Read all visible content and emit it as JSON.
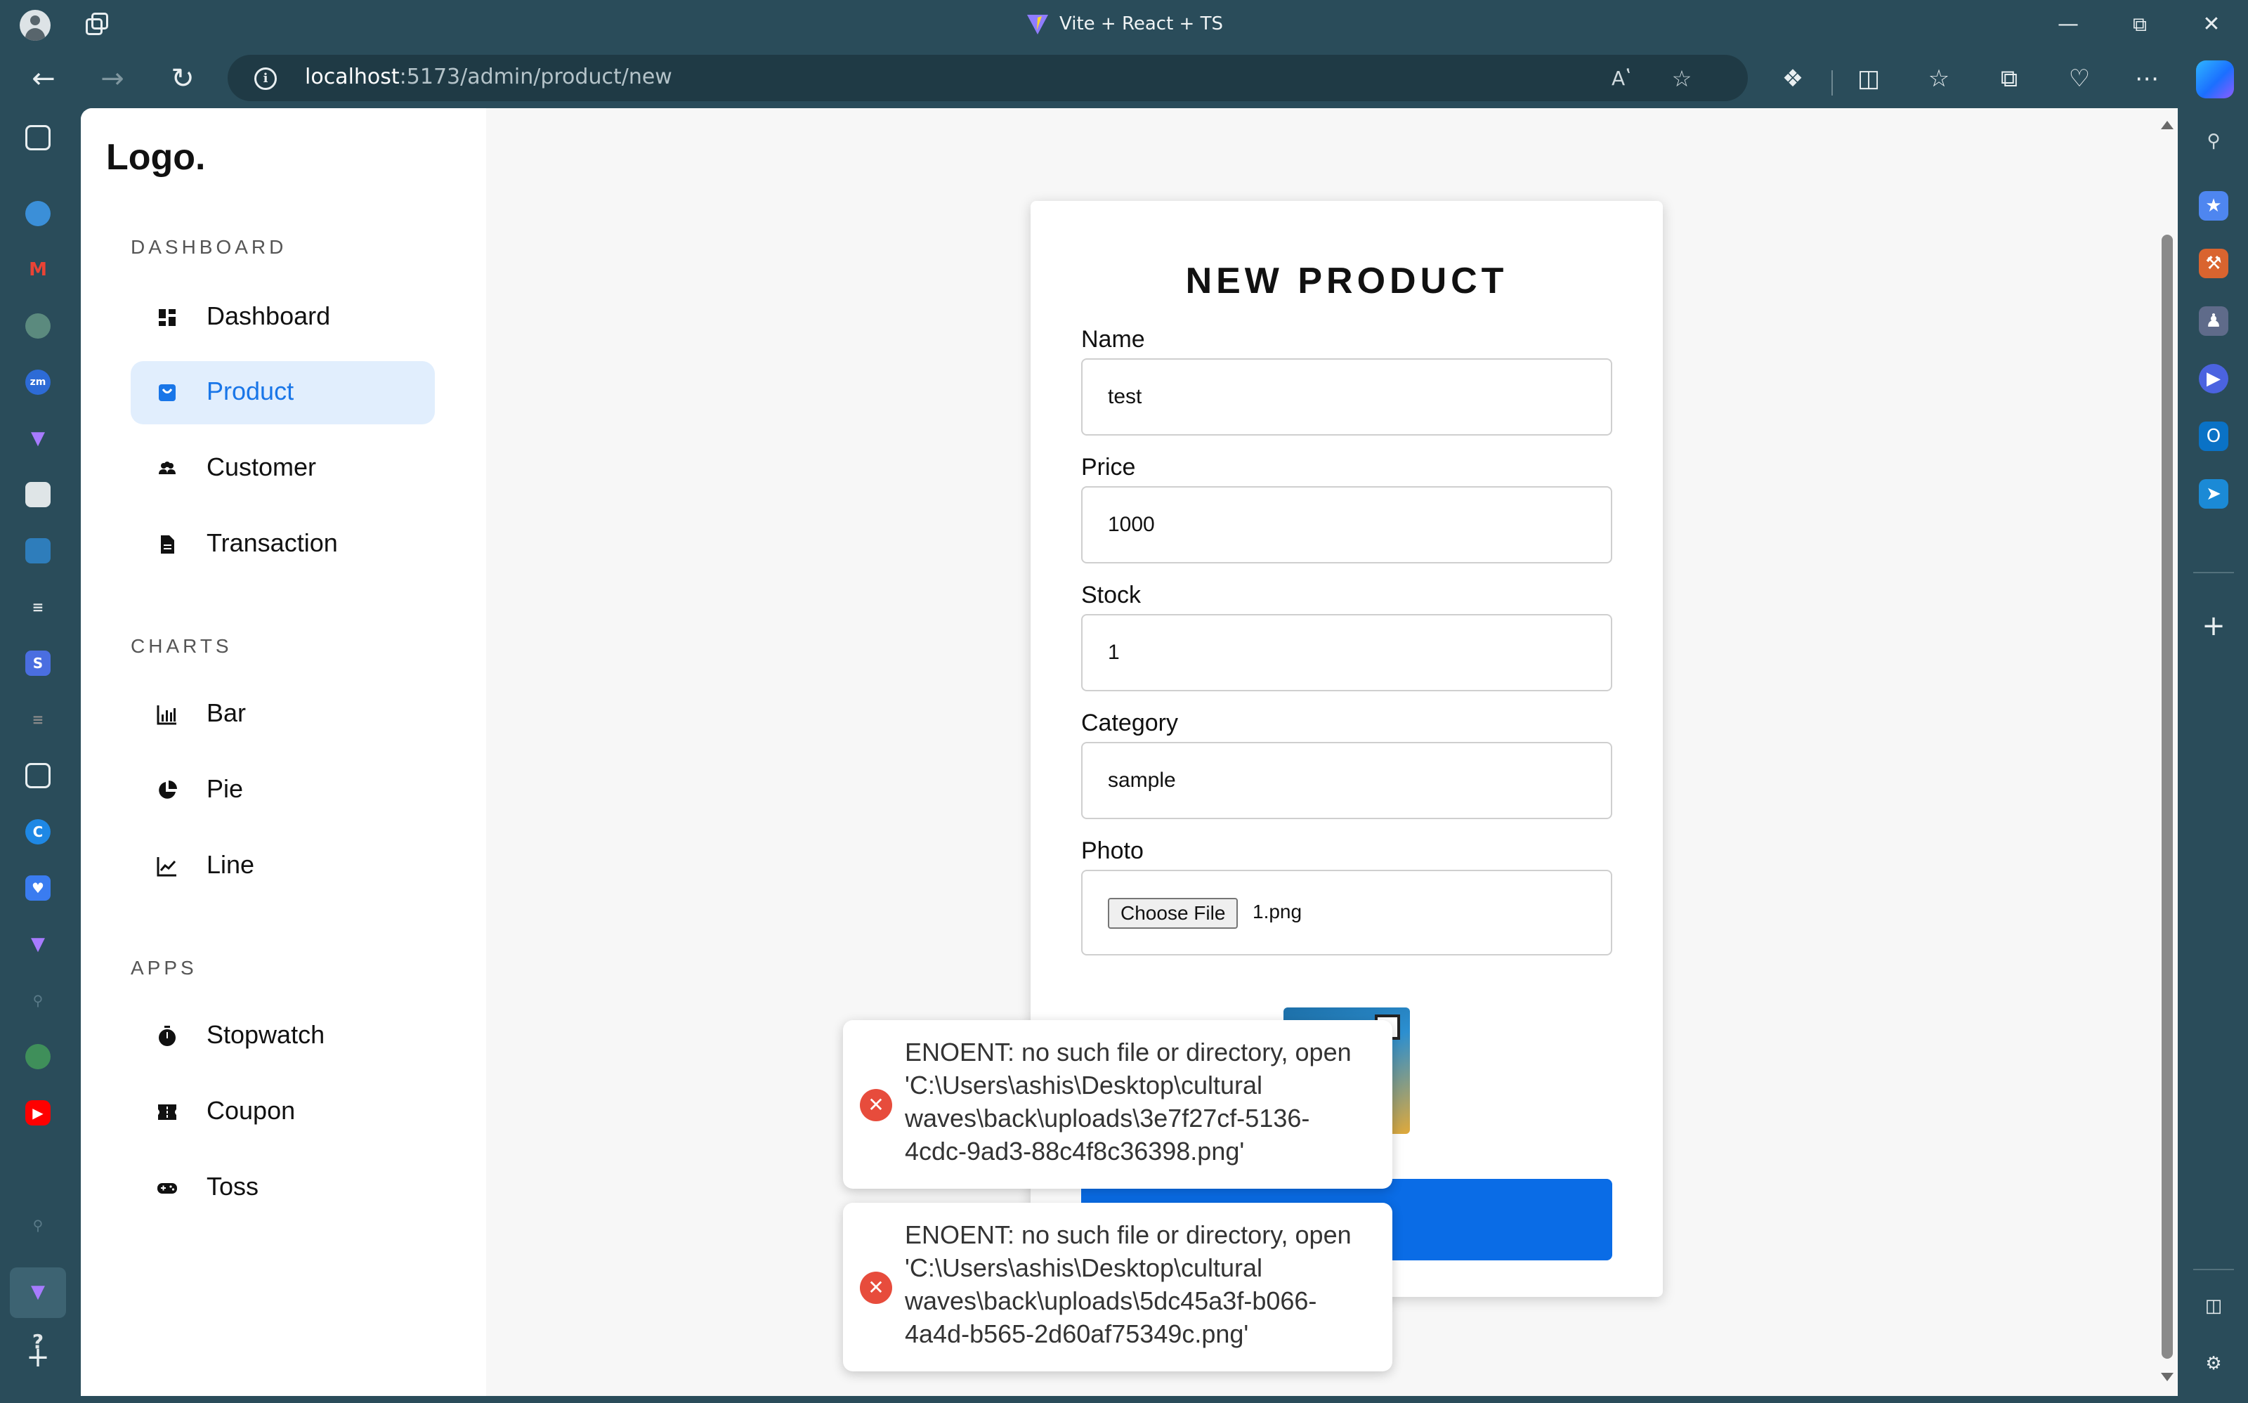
{
  "browser": {
    "window_title": "Vite + React + TS",
    "url_host": "localhost",
    "url_path": ":5173/admin/product/new",
    "controls": {
      "minimize": "—",
      "restore": "⧉",
      "close": "✕"
    }
  },
  "sidebar": {
    "logo": "Logo.",
    "sections": [
      {
        "label": "DASHBOARD",
        "items": [
          {
            "label": "Dashboard",
            "icon": "dashboard-icon",
            "active": false
          },
          {
            "label": "Product",
            "icon": "shopping-bag-icon",
            "active": true
          },
          {
            "label": "Customer",
            "icon": "people-icon",
            "active": false
          },
          {
            "label": "Transaction",
            "icon": "document-icon",
            "active": false
          }
        ]
      },
      {
        "label": "CHARTS",
        "items": [
          {
            "label": "Bar",
            "icon": "bar-chart-icon"
          },
          {
            "label": "Pie",
            "icon": "pie-chart-icon"
          },
          {
            "label": "Line",
            "icon": "line-chart-icon"
          }
        ]
      },
      {
        "label": "APPS",
        "items": [
          {
            "label": "Stopwatch",
            "icon": "stopwatch-icon"
          },
          {
            "label": "Coupon",
            "icon": "coupon-icon"
          },
          {
            "label": "Toss",
            "icon": "gamepad-icon"
          }
        ]
      }
    ]
  },
  "form": {
    "title": "NEW PRODUCT",
    "fields": {
      "name": {
        "label": "Name",
        "value": "test"
      },
      "price": {
        "label": "Price",
        "value": "1000"
      },
      "stock": {
        "label": "Stock",
        "value": "1"
      },
      "category": {
        "label": "Category",
        "value": "sample"
      },
      "photo": {
        "label": "Photo",
        "button": "Choose File",
        "file": "1.png"
      }
    }
  },
  "toasts": [
    {
      "type": "error",
      "message": "ENOENT: no such file or directory, open 'C:\\Users\\ashis\\Desktop\\cultural waves\\back\\uploads\\3e7f27cf-5136-4cdc-9ad3-88c4f8c36398.png'"
    },
    {
      "type": "error",
      "message": "ENOENT: no such file or directory, open 'C:\\Users\\ashis\\Desktop\\cultural waves\\back\\uploads\\5dc45a3f-b066-4a4d-b565-2d60af75349c.png'"
    }
  ],
  "colors": {
    "accent": "#1976e8",
    "active_bg": "#e1eefd",
    "button": "#0a6ce6",
    "error": "#e74c3c",
    "chrome": "#2a4c5a"
  }
}
